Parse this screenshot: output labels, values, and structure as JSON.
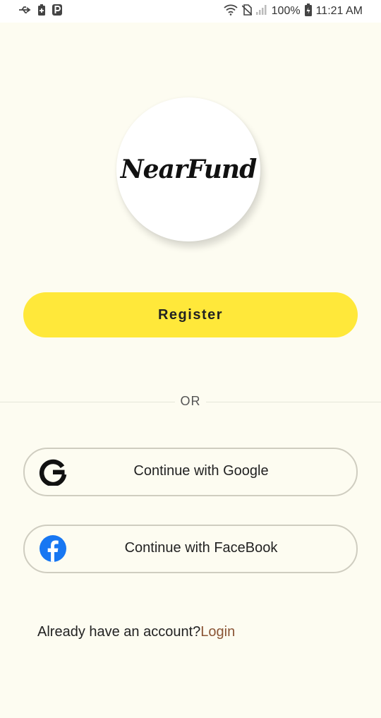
{
  "status_bar": {
    "battery": "100%",
    "time": "11:21 AM"
  },
  "app": {
    "logo_text": "NearFund"
  },
  "actions": {
    "register_label": "Register",
    "or_label": "OR",
    "google_label": "Continue with Google",
    "facebook_label": "Continue with FaceBook"
  },
  "footer": {
    "prompt": "Already have an account?",
    "login_label": "Login"
  },
  "colors": {
    "background": "#FDFCF1",
    "accent": "#FFE83A",
    "link": "#8A5535",
    "facebook_blue": "#1877F2"
  },
  "icons": [
    "usb-icon",
    "battery-saver-icon",
    "parking-icon",
    "wifi-icon",
    "no-sim-icon",
    "signal-icon",
    "battery-icon",
    "google-icon",
    "facebook-icon"
  ]
}
